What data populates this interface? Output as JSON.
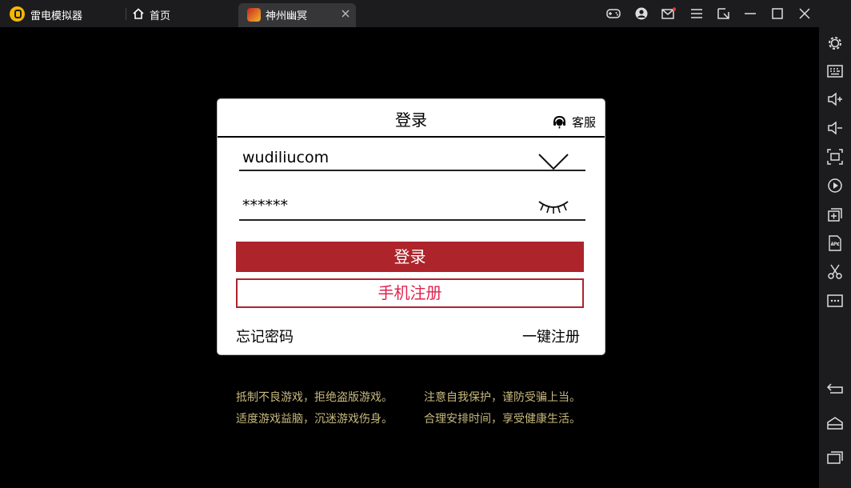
{
  "titlebar": {
    "app_name": "雷电模拟器",
    "home_tab": "首页",
    "game_tab": "神州幽冥"
  },
  "login": {
    "title": "登录",
    "service": "客服",
    "username_value": "wudiliucom",
    "password_value": "******",
    "login_button": "登录",
    "register_button": "手机注册",
    "forgot_password": "忘记密码",
    "one_key_register": "一键注册"
  },
  "notice": {
    "line1_left": "抵制不良游戏，拒绝盗版游戏。",
    "line1_right": "注意自我保护，谨防受骗上当。",
    "line2_left": "适度游戏益脑，沉迷游戏伤身。",
    "line2_right": "合理安排时间，享受健康生活。"
  },
  "colors": {
    "accent_red": "#ad242b",
    "register_text": "#e0244f",
    "notice_text": "#c8b97e",
    "chrome_bg": "#1c1c1e"
  }
}
